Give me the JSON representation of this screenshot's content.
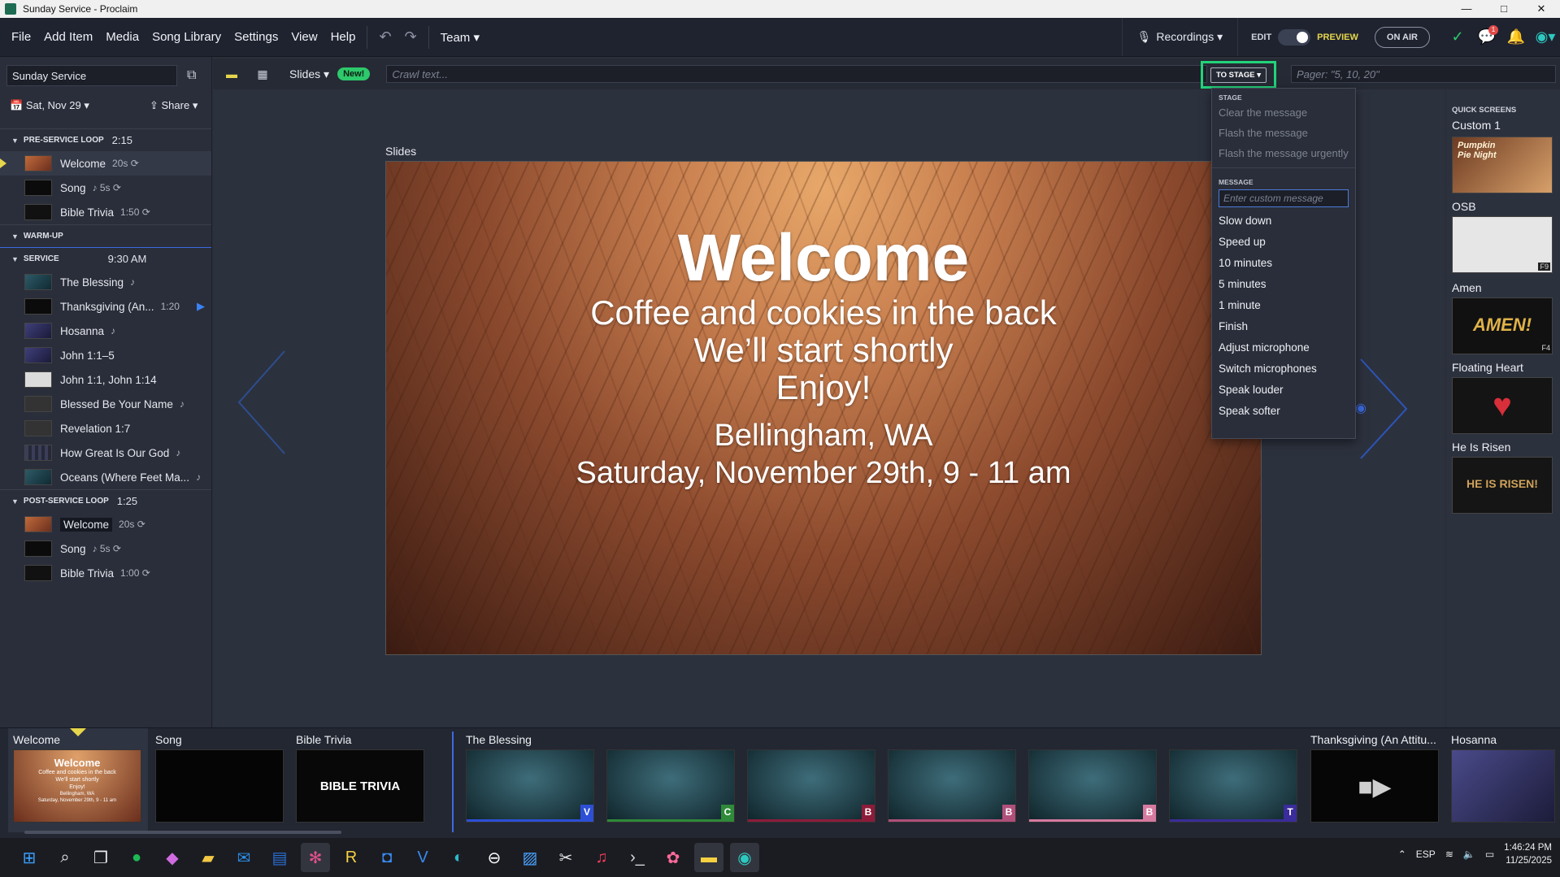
{
  "window": {
    "title": "Sunday Service - Proclaim",
    "minimize": "—",
    "maximize": "□",
    "close": "✕"
  },
  "menu": {
    "items": [
      "File",
      "Add Item",
      "Media",
      "Song Library",
      "Settings",
      "View",
      "Help"
    ],
    "team": "Team ▾",
    "recordings": "Recordings ▾",
    "edit": "EDIT",
    "preview": "PREVIEW",
    "on_air": "ON AIR",
    "chat_badge": "1"
  },
  "sidebar": {
    "presentation": "Sunday Service",
    "date": "Sat, Nov 29 ▾",
    "share": "Share ▾",
    "sections": [
      {
        "title": "PRE-SERVICE LOOP",
        "duration": "2:15",
        "items": [
          {
            "label": "Welcome",
            "meta": "20s ⟳",
            "thumb": "t-welcome",
            "active": true
          },
          {
            "label": "Song",
            "meta": "♪ 5s ⟳",
            "thumb": "t-black"
          },
          {
            "label": "Bible Trivia",
            "meta": "1:50 ⟳",
            "thumb": "t-trivia"
          }
        ]
      },
      {
        "title": "WARM-UP",
        "duration": "",
        "items": []
      },
      {
        "title": "SERVICE",
        "duration": "9:30 AM",
        "items": [
          {
            "label": "The Blessing",
            "meta": "♪",
            "thumb": "t-blue"
          },
          {
            "label": "Thanksgiving (An...",
            "meta": "1:20",
            "thumb": "t-black"
          },
          {
            "label": "Hosanna",
            "meta": "♪",
            "thumb": "t-purple"
          },
          {
            "label": "John 1:1–5",
            "meta": "",
            "thumb": "t-purple"
          },
          {
            "label": "John 1:1, John 1:14",
            "meta": "",
            "thumb": "t-white"
          },
          {
            "label": "Blessed Be Your Name",
            "meta": "♪",
            "thumb": "t-dark"
          },
          {
            "label": "Revelation 1:7",
            "meta": "",
            "thumb": "t-dark"
          },
          {
            "label": "How Great Is Our God",
            "meta": "♪",
            "thumb": "t-dots"
          },
          {
            "label": "Oceans (Where Feet Ma...",
            "meta": "♪",
            "thumb": "t-blue"
          }
        ]
      },
      {
        "title": "POST-SERVICE LOOP",
        "duration": "1:25",
        "items": [
          {
            "label": "Welcome",
            "meta": "20s ⟳",
            "thumb": "t-welcome"
          },
          {
            "label": "Song",
            "meta": "♪ 5s ⟳",
            "thumb": "t-black"
          },
          {
            "label": "Bible Trivia",
            "meta": "1:00 ⟳",
            "thumb": "t-trivia"
          }
        ]
      }
    ]
  },
  "toolbar": {
    "slides": "Slides ▾",
    "new_badge": "New!",
    "crawl_placeholder": "Crawl text...",
    "to_stage": "TO STAGE ▾",
    "pager_placeholder": "Pager: \"5, 10, 20\""
  },
  "main": {
    "label": "Slides",
    "slide": {
      "title": "Welcome",
      "lines": [
        "Coffee and cookies in the back",
        "We’ll start shortly",
        "Enjoy!"
      ],
      "place": "Bellingham, WA",
      "when": "Saturday, November 29th, 9 - 11 am"
    }
  },
  "stage_menu": {
    "stage_header": "STAGE",
    "disabled": [
      "Clear the message",
      "Flash the message",
      "Flash the message urgently"
    ],
    "message_header": "MESSAGE",
    "input_placeholder": "Enter custom message",
    "options": [
      "Slow down",
      "Speed up",
      "10 minutes",
      "5 minutes",
      "1 minute",
      "Finish",
      "Adjust microphone",
      "Switch microphones",
      "Speak louder",
      "Speak softer"
    ]
  },
  "quick_screens": {
    "title": "QUICK SCREENS",
    "items": [
      {
        "name": "Custom 1",
        "key": "",
        "thumb_text": "Pumpkin Pie Night"
      },
      {
        "name": "OSB",
        "key": "F9",
        "thumb_text": ""
      },
      {
        "name": "Amen",
        "key": "F4",
        "thumb_text": "AMEN!"
      },
      {
        "name": "Floating Heart",
        "key": "",
        "thumb_text": "♥"
      },
      {
        "name": "He Is Risen",
        "key": "",
        "thumb_text": "HE IS RISEN!"
      }
    ]
  },
  "strip": {
    "items": [
      "Welcome",
      "Song",
      "Bible Trivia",
      "The Blessing",
      "",
      "",
      "",
      "",
      "",
      "Thanksgiving (An Attitu...",
      "Hosanna"
    ],
    "welcome_thumb": {
      "title": "Welcome",
      "lines": [
        "Coffee and cookies in the back",
        "We’ll start shortly",
        "Enjoy!",
        "Bellingham, WA",
        "Saturday, November 29th, 9 - 11 am"
      ]
    },
    "trivia_thumb": "BIBLE TRIVIA",
    "letters": [
      "V",
      "C",
      "B",
      "B",
      "B",
      "T"
    ],
    "letter_colors": [
      "#2c4fd6",
      "#2f8a3a",
      "#8c1c3a",
      "#b0507a",
      "#d67aa0",
      "#3a2c9a"
    ]
  },
  "taskbar": {
    "lang": "ESP",
    "time": "1:46:24 PM",
    "date": "11/25/2025"
  }
}
